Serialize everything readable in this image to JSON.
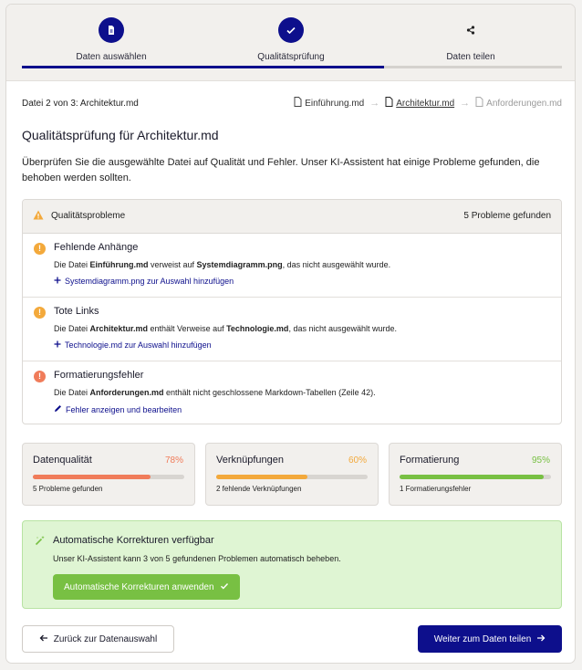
{
  "stepper": {
    "steps": [
      {
        "label": "Daten auswählen",
        "icon": "document-icon",
        "state": "done"
      },
      {
        "label": "Qualitätsprüfung",
        "icon": "check-icon",
        "state": "active"
      },
      {
        "label": "Daten teilen",
        "icon": "share-icon",
        "state": "pending"
      }
    ],
    "progress_fraction": 0.67
  },
  "file_nav": {
    "counter": "Datei 2 von 3:  Architektur.md",
    "files": [
      "Einführung.md",
      "Architektur.md",
      "Anforderungen.md"
    ]
  },
  "title": "Qualitätsprüfung für Architektur.md",
  "description": "Überprüfen Sie die ausgewählte Datei auf Qualität und Fehler. Unser KI-Assistent hat einige Probleme gefunden, die behoben werden sollten.",
  "issues_panel": {
    "heading": "Qualitätsprobleme",
    "count": "5 Probleme gefunden",
    "items": [
      {
        "title": "Fehlende Anhänge",
        "desc_pre": "Die Datei ",
        "desc_b1": "Einführung.md",
        "desc_mid": " verweist auf ",
        "desc_b2": "Systemdiagramm.png",
        "desc_post": ", das nicht ausgewählt wurde.",
        "action": "Systemdiagramm.png zur Auswahl hinzufügen",
        "action_icon": "plus-icon",
        "color": "#f3a93b"
      },
      {
        "title": "Tote Links",
        "desc_pre": "Die Datei ",
        "desc_b1": "Architektur.md",
        "desc_mid": " enthält Verweise auf ",
        "desc_b2": "Technologie.md",
        "desc_post": ", das nicht ausgewählt wurde.",
        "action": "Technologie.md zur Auswahl hinzufügen",
        "action_icon": "plus-icon",
        "color": "#f3a93b"
      },
      {
        "title": "Formatierungsfehler",
        "desc_pre": "Die Datei ",
        "desc_b1": "Anforderungen.md",
        "desc_mid": " enthält nicht geschlossene Markdown-Tabellen (Zeile 42).",
        "desc_b2": "",
        "desc_post": "",
        "action": "Fehler anzeigen und bearbeiten",
        "action_icon": "pencil-icon",
        "color": "#f07c5a"
      }
    ]
  },
  "metrics": [
    {
      "name": "Datenqualität",
      "percent": "78%",
      "value": 0.78,
      "sub": "5 Probleme gefunden",
      "color": "#f07c5a"
    },
    {
      "name": "Verknüpfungen",
      "percent": "60%",
      "value": 0.6,
      "sub": "2 fehlende Verknüpfungen",
      "color": "#f3a93b"
    },
    {
      "name": "Formatierung",
      "percent": "95%",
      "value": 0.95,
      "sub": "1 Formatierungsfehler",
      "color": "#78c043"
    }
  ],
  "auto_fix": {
    "title": "Automatische Korrekturen verfügbar",
    "desc": "Unser KI-Assistent kann 3 von 5 gefundenen Problemen automatisch beheben.",
    "button": "Automatische Korrekturen anwenden"
  },
  "footer": {
    "back": "Zurück zur Datenauswahl",
    "next": "Weiter zum Daten teilen"
  },
  "colors": {
    "primary": "#0d0f8c",
    "warning": "#f3a93b",
    "error": "#f07c5a",
    "success": "#78c043"
  }
}
